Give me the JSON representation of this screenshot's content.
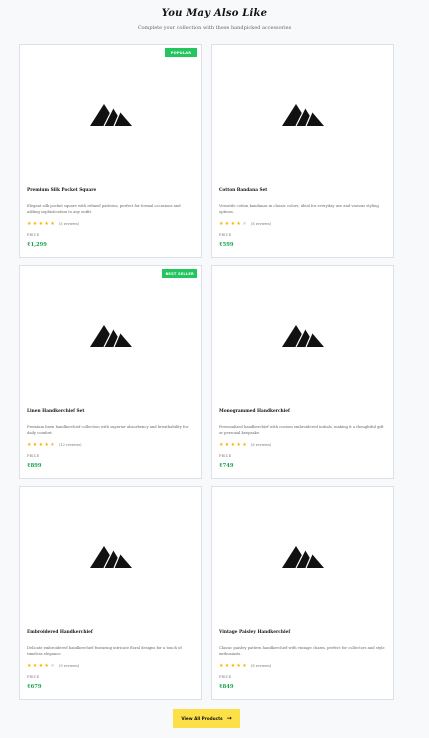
{
  "section": {
    "title": "You May Also Like",
    "subtitle": "Complete your collection with these handpicked accessories"
  },
  "price_label": "PRICE",
  "products": [
    {
      "name": "Premium Silk Pocket Square",
      "description": "Elegant silk pocket square with refined patterns, perfect for formal occasions and adding sophistication to any outfit.",
      "rating": 5,
      "reviews": "(5 reviews)",
      "price": "₹1,299",
      "badge": "POPULAR",
      "image_icon": "mountain-placeholder-icon"
    },
    {
      "name": "Cotton Bandana Set",
      "description": "Versatile cotton bandanas in classic colors, ideal for everyday use and various styling options.",
      "rating": 4,
      "reviews": "(8 reviews)",
      "price": "₹599",
      "badge": "",
      "image_icon": "mountain-placeholder-icon"
    },
    {
      "name": "Linen Handkerchief Set",
      "description": "Premium linen handkerchief collection with superior absorbency and breathability for daily comfort.",
      "rating": 4.5,
      "reviews": "(12 reviews)",
      "price": "₹899",
      "badge": "BEST SELLER",
      "image_icon": "mountain-placeholder-icon"
    },
    {
      "name": "Monogrammed Handkerchief",
      "description": "Personalized handkerchief with custom embroidered initials, making it a thoughtful gift or personal keepsake.",
      "rating": 5,
      "reviews": "(6 reviews)",
      "price": "₹749",
      "badge": "",
      "image_icon": "mountain-placeholder-icon"
    },
    {
      "name": "Embroidered Handkerchief",
      "description": "Delicate embroidered handkerchief featuring intricate floral designs for a touch of timeless elegance.",
      "rating": 4,
      "reviews": "(9 reviews)",
      "price": "₹679",
      "badge": "",
      "image_icon": "mountain-placeholder-icon"
    },
    {
      "name": "Vintage Paisley Handkerchief",
      "description": "Classic paisley pattern handkerchief with vintage charm, perfect for collectors and style enthusiasts.",
      "rating": 5,
      "reviews": "(8 reviews)",
      "price": "₹849",
      "badge": "",
      "image_icon": "mountain-placeholder-icon"
    }
  ],
  "view_all": {
    "label": "View All Products",
    "icon": "arrow-right-icon"
  },
  "colors": {
    "accent_green": "#22c55e",
    "price_green": "#16a34a",
    "star_gold": "#f5b400",
    "button_yellow": "#fde047"
  }
}
